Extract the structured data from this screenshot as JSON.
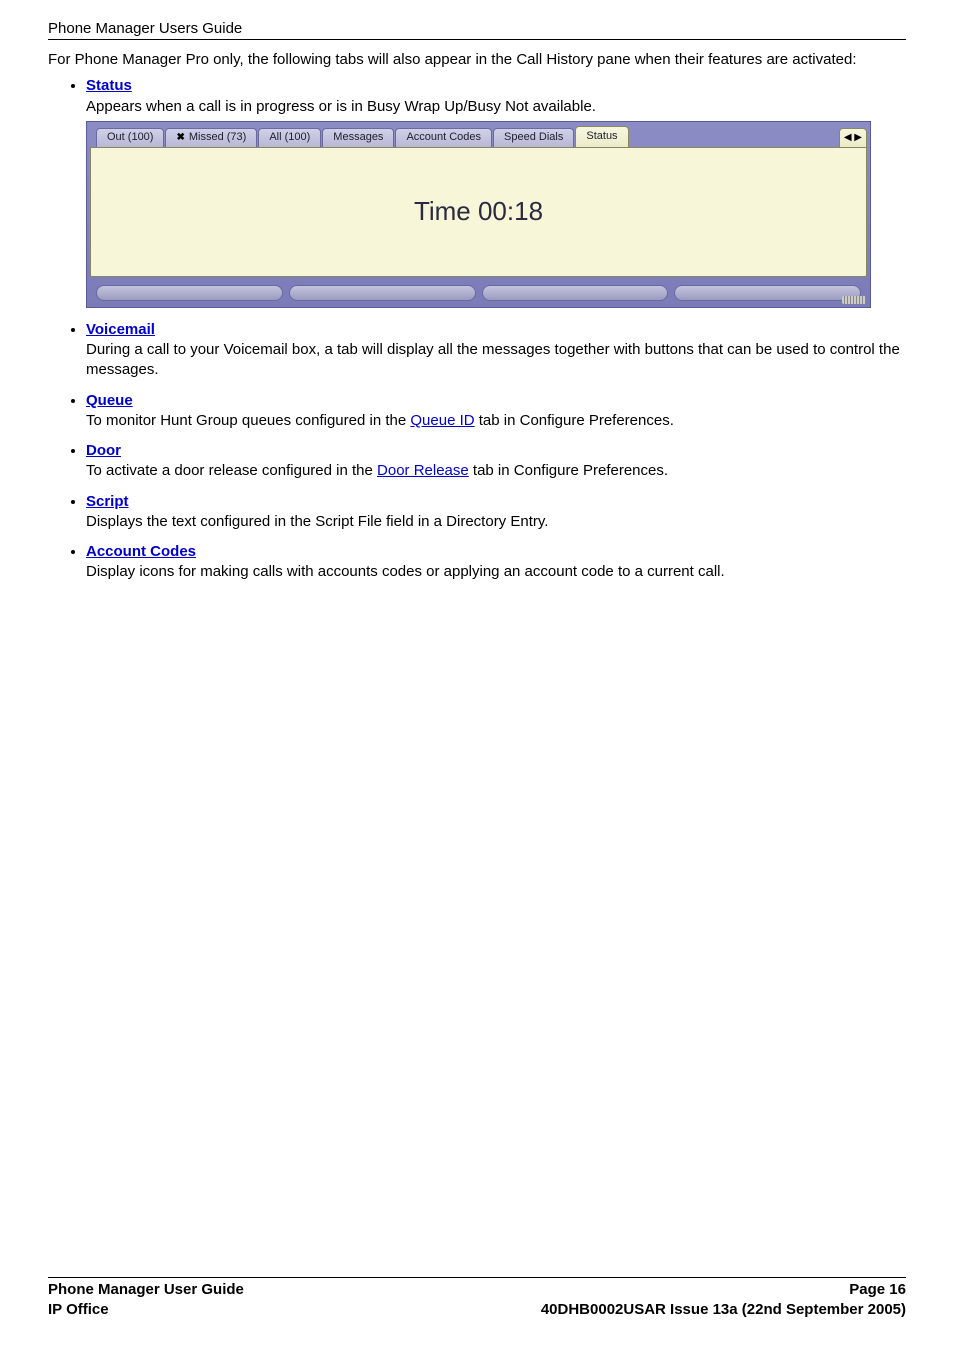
{
  "header": {
    "title": "Phone Manager Users Guide"
  },
  "intro": "For Phone Manager Pro only, the following tabs will also appear in the Call History pane when their features are activated:",
  "items": [
    {
      "link_label": "Status",
      "desc_pre": "Appears when a call is in progress or is in Busy Wrap Up/Busy Not available."
    },
    {
      "link_label": "Voicemail",
      "desc_pre": "During a call to your Voicemail box, a tab will display all the messages together with buttons that can be used to control the messages."
    },
    {
      "link_label": "Queue",
      "desc_pre": "To monitor Hunt Group queues configured in the ",
      "inline_link": "Queue ID",
      "desc_post": " tab in Configure Preferences."
    },
    {
      "link_label": "Door",
      "desc_pre": "To activate a door release configured in the ",
      "inline_link": "Door Release",
      "desc_post": " tab in Configure Preferences."
    },
    {
      "link_label": "Script",
      "desc_pre": "Displays the text configured in the Script File field in a Directory Entry."
    },
    {
      "link_label": "Account Codes",
      "desc_pre": "Display icons for making calls with accounts codes or applying an account code to a current call."
    }
  ],
  "screenshot": {
    "tabs": [
      {
        "label": "Out (100)",
        "icon": ""
      },
      {
        "label": "Missed (73)",
        "icon": "✖"
      },
      {
        "label": "All (100)",
        "icon": ""
      },
      {
        "label": "Messages",
        "icon": ""
      },
      {
        "label": "Account Codes",
        "icon": ""
      },
      {
        "label": "Speed Dials",
        "icon": ""
      },
      {
        "label": "Status",
        "icon": "",
        "active": true
      }
    ],
    "arrows": "◀ ▶",
    "time_text": "Time 00:18"
  },
  "chart_data": {
    "type": "table",
    "title": "Call History tab counts",
    "categories": [
      "Out",
      "Missed",
      "All"
    ],
    "values": [
      100,
      73,
      100
    ]
  },
  "footer": {
    "left_top": "Phone Manager User Guide",
    "left_bottom": "IP Office",
    "right_top": "Page 16",
    "right_bottom": "40DHB0002USAR Issue 13a (22nd September 2005)"
  }
}
